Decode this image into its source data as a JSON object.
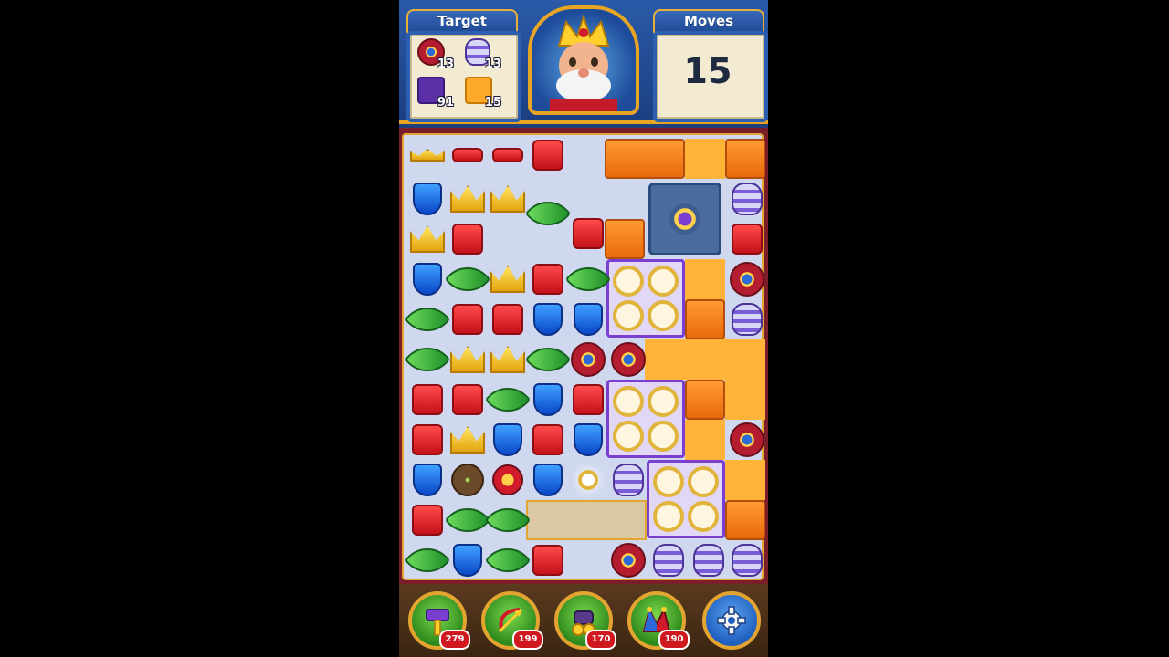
{
  "hud": {
    "target_label": "Target",
    "moves_label": "Moves",
    "moves_value": "15",
    "targets": [
      {
        "icon": "donut-icon",
        "count": "13"
      },
      {
        "icon": "vase-icon",
        "count": "13"
      },
      {
        "icon": "purple-tile-icon",
        "count": "91"
      },
      {
        "icon": "orange-tile-icon",
        "count": "15"
      }
    ]
  },
  "boosters": [
    {
      "name": "hammer-booster",
      "icon": "hammer-icon",
      "count": "279"
    },
    {
      "name": "arrow-booster",
      "icon": "arrow-icon",
      "count": "199"
    },
    {
      "name": "cannon-booster",
      "icon": "cannon-icon",
      "count": "170"
    },
    {
      "name": "jester-booster",
      "icon": "jester-hat-icon",
      "count": "190"
    }
  ],
  "colors": {
    "hud_blue": "#2a5aa8",
    "gold_border": "#e7a524",
    "board_bg": "#cfd8ee",
    "orange_tile": "#ff9a34",
    "purple_cage": "#7a3fd0"
  }
}
